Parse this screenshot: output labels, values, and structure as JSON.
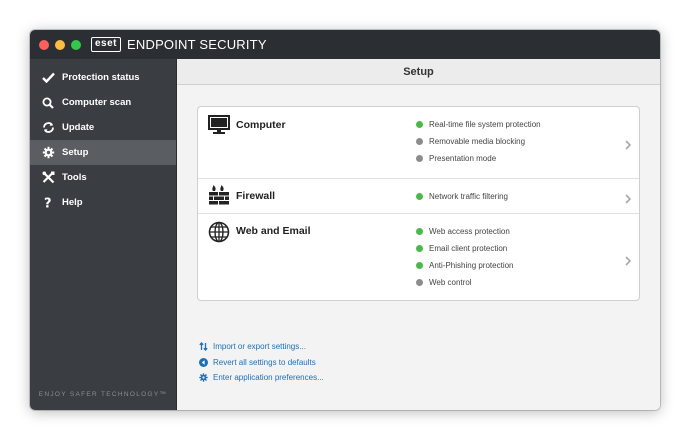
{
  "window": {
    "logo_text": "eset",
    "title": "ENDPOINT SECURITY"
  },
  "sidebar": {
    "items": [
      {
        "label": "Protection status",
        "icon": "check-icon"
      },
      {
        "label": "Computer scan",
        "icon": "search-icon"
      },
      {
        "label": "Update",
        "icon": "refresh-icon"
      },
      {
        "label": "Setup",
        "icon": "gear-icon",
        "active": true
      },
      {
        "label": "Tools",
        "icon": "tools-icon"
      },
      {
        "label": "Help",
        "icon": "question-icon"
      }
    ],
    "footer": "ENJOY SAFER TECHNOLOGY™"
  },
  "main": {
    "title": "Setup",
    "sections": [
      {
        "title": "Computer",
        "icon": "monitor-icon",
        "features": [
          {
            "label": "Real-time file system protection",
            "status": "enabled"
          },
          {
            "label": "Removable media blocking",
            "status": "disabled"
          },
          {
            "label": "Presentation mode",
            "status": "disabled"
          }
        ]
      },
      {
        "title": "Firewall",
        "icon": "firewall-icon",
        "features": [
          {
            "label": "Network traffic filtering",
            "status": "enabled"
          }
        ]
      },
      {
        "title": "Web and Email",
        "icon": "globe-icon",
        "features": [
          {
            "label": "Web access protection",
            "status": "enabled"
          },
          {
            "label": "Email client protection",
            "status": "enabled"
          },
          {
            "label": "Anti-Phishing protection",
            "status": "enabled"
          },
          {
            "label": "Web control",
            "status": "disabled"
          }
        ]
      }
    ],
    "links": [
      {
        "label": "Import or export settings...",
        "icon": "import-export-icon"
      },
      {
        "label": "Revert all settings to defaults",
        "icon": "revert-icon"
      },
      {
        "label": "Enter application preferences...",
        "icon": "gear-icon"
      }
    ]
  },
  "colors": {
    "enabled": "#4cb848",
    "disabled": "#8c8c8c",
    "link": "#1f6fb6",
    "sidebar_bg": "#3a3e42",
    "sidebar_active": "#5a5e62",
    "titlebar_bg": "#2b2f33"
  }
}
